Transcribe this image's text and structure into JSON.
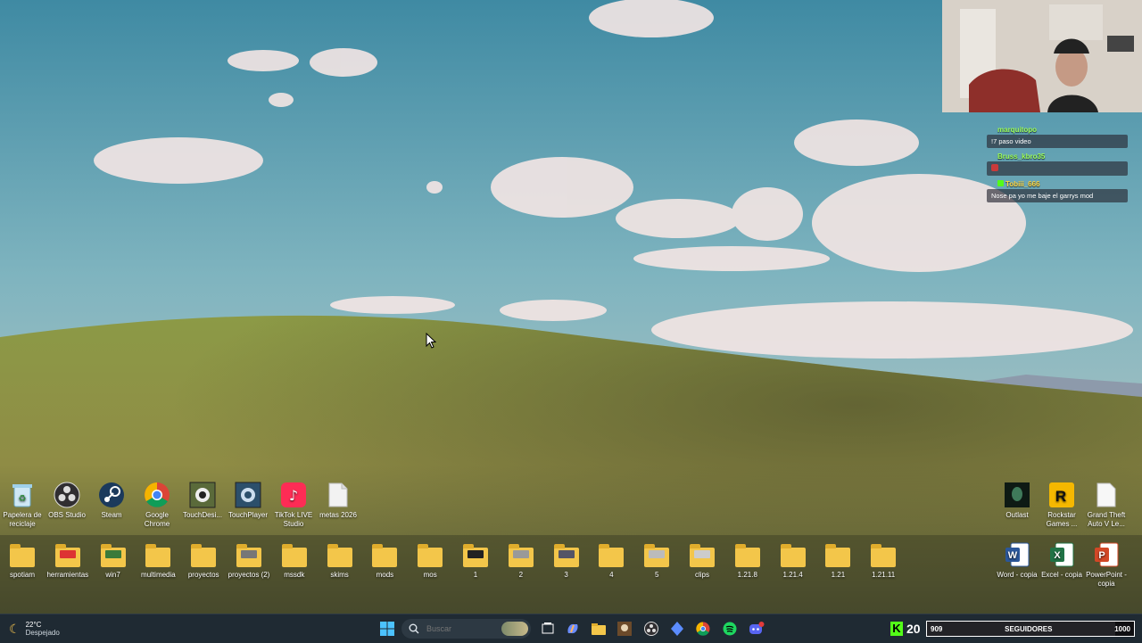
{
  "chat": {
    "messages": [
      {
        "user": "marquitopo",
        "text": "!7 paso video",
        "color": "#9dff5a"
      },
      {
        "user": "Bruss_kbro35",
        "text": "",
        "color": "#9dff5a"
      },
      {
        "user": "Tobiii_666",
        "text": "Nose pa yo me baje el garrys mod",
        "color": "#ffd640"
      }
    ]
  },
  "desktop": {
    "row1": [
      {
        "label": "Papelera de reciclaje",
        "icon": "recycle-bin-icon"
      },
      {
        "label": "OBS Studio",
        "icon": "obs-icon"
      },
      {
        "label": "Steam",
        "icon": "steam-icon"
      },
      {
        "label": "Google Chrome",
        "icon": "chrome-icon"
      },
      {
        "label": "TouchDesi...",
        "icon": "touchdesigner-icon"
      },
      {
        "label": "TouchPlayer",
        "icon": "touchplayer-icon"
      },
      {
        "label": "TikTok LIVE Studio",
        "icon": "tiktok-icon"
      },
      {
        "label": "metas 2026",
        "icon": "text-file-icon"
      }
    ],
    "row1_right": [
      {
        "label": "Outlast",
        "icon": "outlast-icon"
      },
      {
        "label": "Rockstar Games ...",
        "icon": "rockstar-icon"
      },
      {
        "label": "Grand Theft Auto V Le...",
        "icon": "file-icon"
      }
    ],
    "row2": [
      {
        "label": "spotiam"
      },
      {
        "label": "herramientas"
      },
      {
        "label": "win7"
      },
      {
        "label": "multimedia"
      },
      {
        "label": "proyectos"
      },
      {
        "label": "proyectos (2)"
      },
      {
        "label": "mssdk"
      },
      {
        "label": "skims"
      },
      {
        "label": "mods"
      },
      {
        "label": "mos"
      },
      {
        "label": "1"
      },
      {
        "label": "2"
      },
      {
        "label": "3"
      },
      {
        "label": "4"
      },
      {
        "label": "5"
      },
      {
        "label": "clips"
      },
      {
        "label": "1.21.8"
      },
      {
        "label": "1.21.4"
      },
      {
        "label": "1.21"
      },
      {
        "label": "1.21.11"
      }
    ],
    "row2_right": [
      {
        "label": "Word - copia",
        "icon": "word-icon"
      },
      {
        "label": "Excel - copia",
        "icon": "excel-icon"
      },
      {
        "label": "PowerPoint - copia",
        "icon": "powerpoint-icon"
      }
    ]
  },
  "taskbar": {
    "weather": {
      "temp": "22°C",
      "condition": "Despejado"
    },
    "search_placeholder": "Buscar"
  },
  "followers": {
    "count": "20",
    "current": "909",
    "label": "SEGUIDORES",
    "goal": "1000",
    "progress_fraction": 0.909
  }
}
